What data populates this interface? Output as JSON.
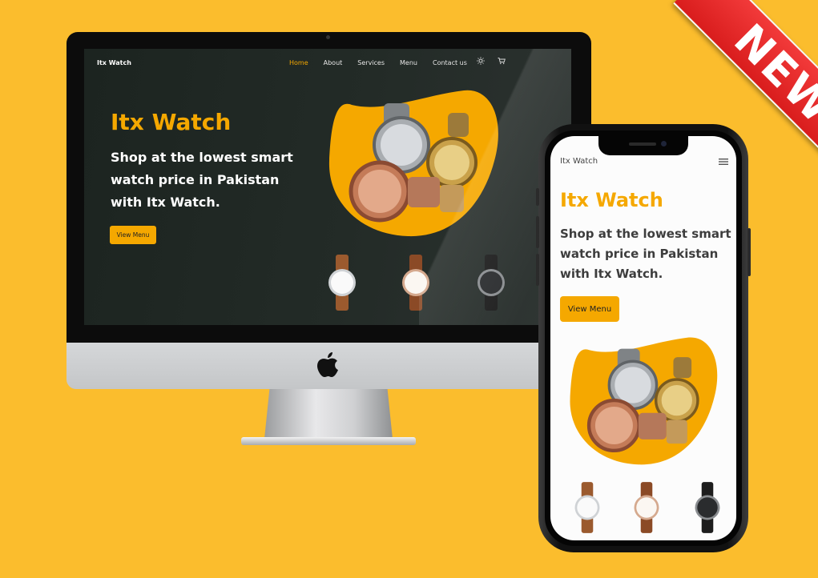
{
  "colors": {
    "background": "#FBBD2D",
    "accent": "#F5A800",
    "ribbon": "#E02424"
  },
  "desktop": {
    "brand": "Itx Watch",
    "nav": [
      "Home",
      "About",
      "Services",
      "Menu",
      "Contact us"
    ],
    "active_nav": "Home",
    "hero_title": "Itx Watch",
    "hero_subtitle": "Shop at the lowest smart watch price in Pakistan with Itx Watch.",
    "cta": "View Menu",
    "icons": [
      "sun-icon",
      "cart-icon"
    ]
  },
  "mobile": {
    "brand": "Itx Watch",
    "hero_title": "Itx Watch",
    "hero_subtitle": "Shop at the lowest smart watch price in Pakistan with Itx Watch.",
    "cta": "View Menu",
    "icons": [
      "hamburger-menu-icon"
    ]
  },
  "badge": {
    "label": "NEW"
  }
}
